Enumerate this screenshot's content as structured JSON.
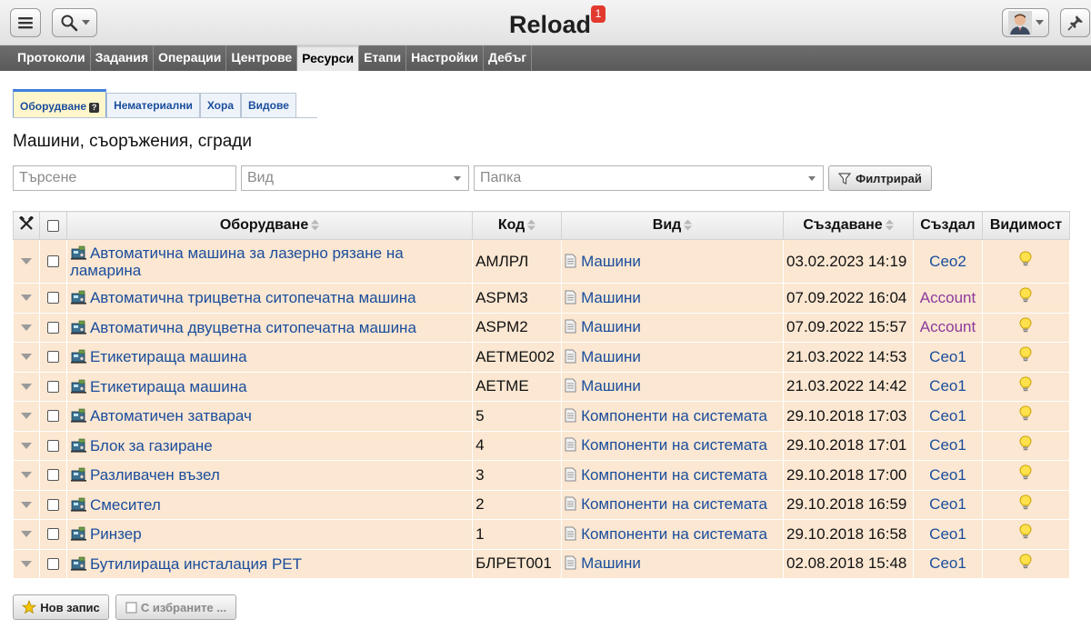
{
  "app": {
    "title": "Reload",
    "notification_count": "1"
  },
  "nav": {
    "tabs": [
      "Протоколи",
      "Задания",
      "Операции",
      "Центрове",
      "Ресурси",
      "Етапи",
      "Настройки",
      "Дебъг"
    ],
    "active": "Ресурси"
  },
  "subtabs": {
    "items": [
      "Оборудване",
      "Нематериални",
      "Хора",
      "Видове"
    ],
    "active": "Оборудване",
    "help_mark": "?"
  },
  "section_title": "Машини, съоръжения, сгради",
  "filters": {
    "search_placeholder": "Търсене",
    "type_placeholder": "Вид",
    "folder_placeholder": "Папка",
    "filter_button": "Филтрирай"
  },
  "table": {
    "columns": {
      "equipment": "Оборудване",
      "code": "Код",
      "type": "Вид",
      "created": "Създаване",
      "created_by": "Създал",
      "visibility": "Видимост"
    },
    "rows": [
      {
        "name": "Автоматична машина за лазерно рязане на ламарина",
        "code": "АМЛРЛ",
        "type": "Машини",
        "created": "03.02.2023 14:19",
        "by": "Ceo2"
      },
      {
        "name": "Автоматична трицветна ситопечатна машина",
        "code": "ASPM3",
        "type": "Машини",
        "created": "07.09.2022 16:04",
        "by": "Account"
      },
      {
        "name": "Автоматична двуцветна ситопечатна машина",
        "code": "ASPM2",
        "type": "Машини",
        "created": "07.09.2022 15:57",
        "by": "Account"
      },
      {
        "name": "Етикетираща машина",
        "code": "AETME002",
        "type": "Машини",
        "created": "21.03.2022 14:53",
        "by": "Ceo1"
      },
      {
        "name": "Етикетираща машина",
        "code": "AETME",
        "type": "Машини",
        "created": "21.03.2022 14:42",
        "by": "Ceo1"
      },
      {
        "name": "Автоматичен затварач",
        "code": "5",
        "type": "Компоненти на системата",
        "created": "29.10.2018 17:03",
        "by": "Ceo1"
      },
      {
        "name": "Блок за газиране",
        "code": "4",
        "type": "Компоненти на системата",
        "created": "29.10.2018 17:01",
        "by": "Ceo1"
      },
      {
        "name": "Разливачен възел",
        "code": "3",
        "type": "Компоненти на системата",
        "created": "29.10.2018 17:00",
        "by": "Ceo1"
      },
      {
        "name": "Смесител",
        "code": "2",
        "type": "Компоненти на системата",
        "created": "29.10.2018 16:59",
        "by": "Ceo1"
      },
      {
        "name": "Ринзер",
        "code": "1",
        "type": "Компоненти на системата",
        "created": "29.10.2018 16:58",
        "by": "Ceo1"
      },
      {
        "name": "Бутилираща инсталация PET",
        "code": "БЛРЕТ001",
        "type": "Машини",
        "created": "02.08.2018 15:48",
        "by": "Ceo1"
      }
    ]
  },
  "actions": {
    "new_record": "Нов запис",
    "with_selected": "С избраните ..."
  },
  "colors": {
    "row_bg": "#fbe7d2",
    "link": "#1a4d9c",
    "account_link": "#8e3a9c",
    "badge": "#e23a2f"
  },
  "icons": {
    "menu": "hamburger-icon",
    "search": "magnifier-icon",
    "user": "avatar-icon",
    "pin": "pin-icon",
    "equipment": "machine-icon",
    "type": "document-icon",
    "visibility": "lightbulb-icon",
    "tools": "tools-icon",
    "new": "star-icon",
    "filter": "funnel-icon"
  }
}
